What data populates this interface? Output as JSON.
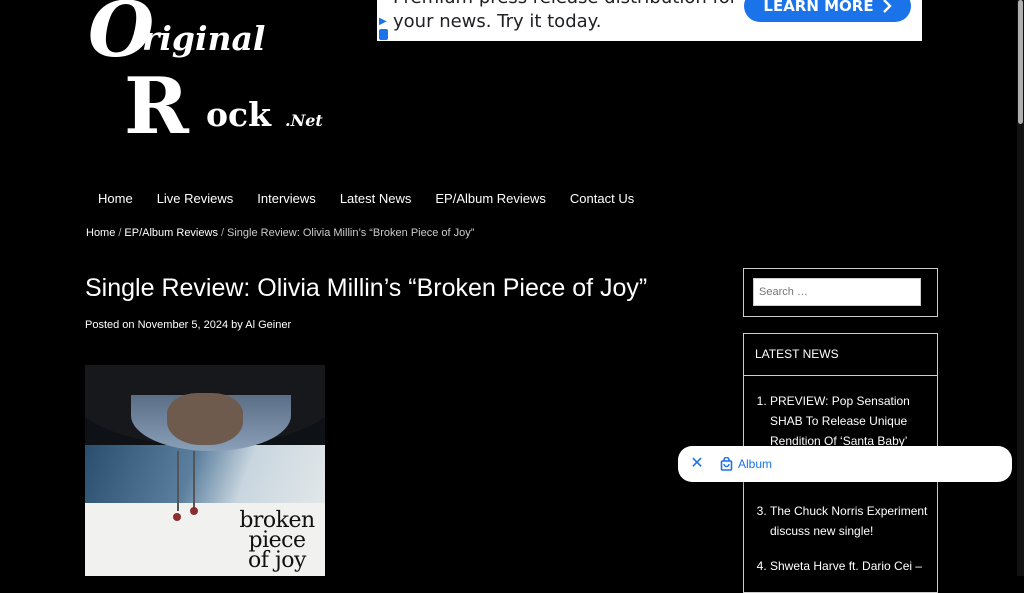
{
  "logo": {
    "line1": "riginal",
    "line2": "ock",
    "suffix": ".Net",
    "big_o": "O",
    "big_r": "R"
  },
  "ad": {
    "text": "Premium press release distribution for your news. Try it today.",
    "cta_label": "LEARN MORE",
    "cta_icon": "chevron-right-icon",
    "colors": {
      "cta": "#1a73e8"
    }
  },
  "nav": {
    "items": [
      "Home",
      "Live Reviews",
      "Interviews",
      "Latest News",
      "EP/Album Reviews",
      "Contact Us"
    ]
  },
  "breadcrumb": {
    "home": "Home",
    "section": "EP/Album Reviews",
    "separator": "/",
    "current": "Single Review: Olivia Millin’s “Broken Piece of Joy”"
  },
  "article": {
    "title": "Single Review: Olivia Millin’s “Broken Piece of Joy”",
    "posted_prefix": "Posted on",
    "date": "November 5, 2024",
    "by_prefix": "by",
    "author": "Al Geiner",
    "cover_text_1": "broken",
    "cover_text_2": "piece",
    "cover_text_3": "of joy"
  },
  "sidebar": {
    "search_placeholder": "Search …",
    "latest_heading": "LATEST NEWS",
    "latest_items": [
      "PREVIEW: Pop Sensation SHAB To Release Unique Rendition Of ‘Santa Baby’",
      "",
      "The Chuck Norris Experiment discuss new single!",
      "Shweta Harve ft. Dario Cei –"
    ]
  },
  "toast": {
    "close_icon": "close-icon",
    "chip_icon": "shopping-bag-icon",
    "chip_label": "Album",
    "colors": {
      "accent": "#1a73e8"
    }
  }
}
